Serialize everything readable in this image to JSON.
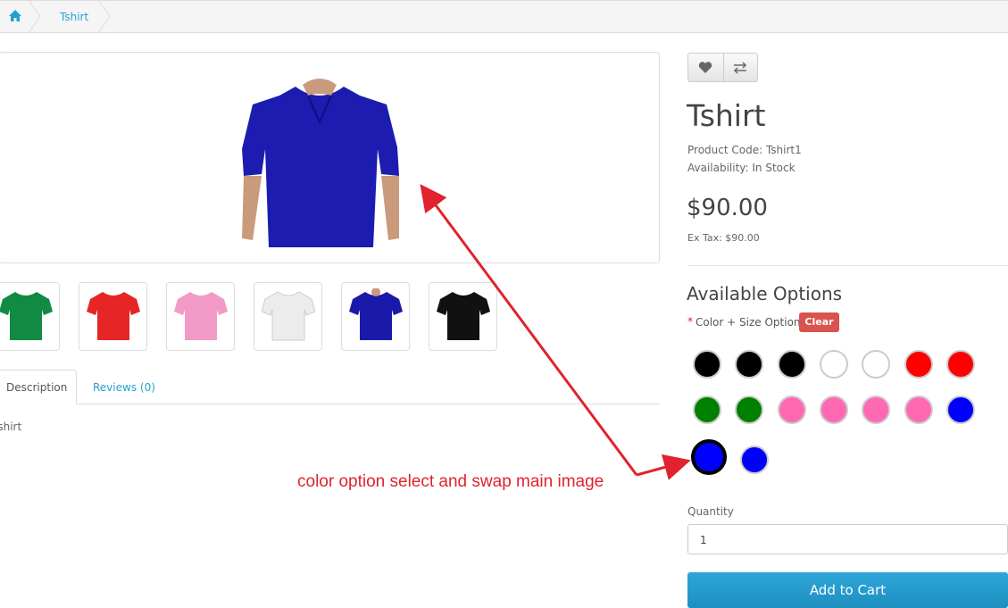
{
  "breadcrumb": {
    "items": [
      "Tshirt"
    ]
  },
  "product": {
    "title": "Tshirt",
    "product_code": "Product Code: Tshirt1",
    "availability": "Availability: In Stock",
    "price": "$90.00",
    "ex_tax": "Ex Tax: $90.00"
  },
  "tabs": {
    "description": "Description",
    "reviews": "Reviews (0)"
  },
  "description_text": "Tshirt",
  "options": {
    "title": "Available Options",
    "required_mark": "*",
    "label": "Color + Size Option",
    "clear": "Clear",
    "swatches": [
      "#000000",
      "#000000",
      "#000000",
      "#ffffff",
      "#ffffff",
      "#ff0000",
      "#ff0000",
      "#008000",
      "#008000",
      "#ff69b4",
      "#ff69b4",
      "#ff69b4",
      "#ff69b4",
      "#0000ff",
      "#0000ff",
      "#0000ff"
    ],
    "selected_index": 14
  },
  "thumbnails": [
    "#118a44",
    "#e62626",
    "#f29ac6",
    "#ececec",
    "#1a1aaa",
    "#111111"
  ],
  "annotation": "color option select and swap main image",
  "quantity": {
    "label": "Quantity",
    "value": "1"
  },
  "add_to_cart": "Add to Cart",
  "colors": {
    "accent": "#23a1d1",
    "danger": "#d9534f",
    "arrow": "#e0232c"
  },
  "icons": [
    "home-icon",
    "heart-icon",
    "compare-icon"
  ]
}
